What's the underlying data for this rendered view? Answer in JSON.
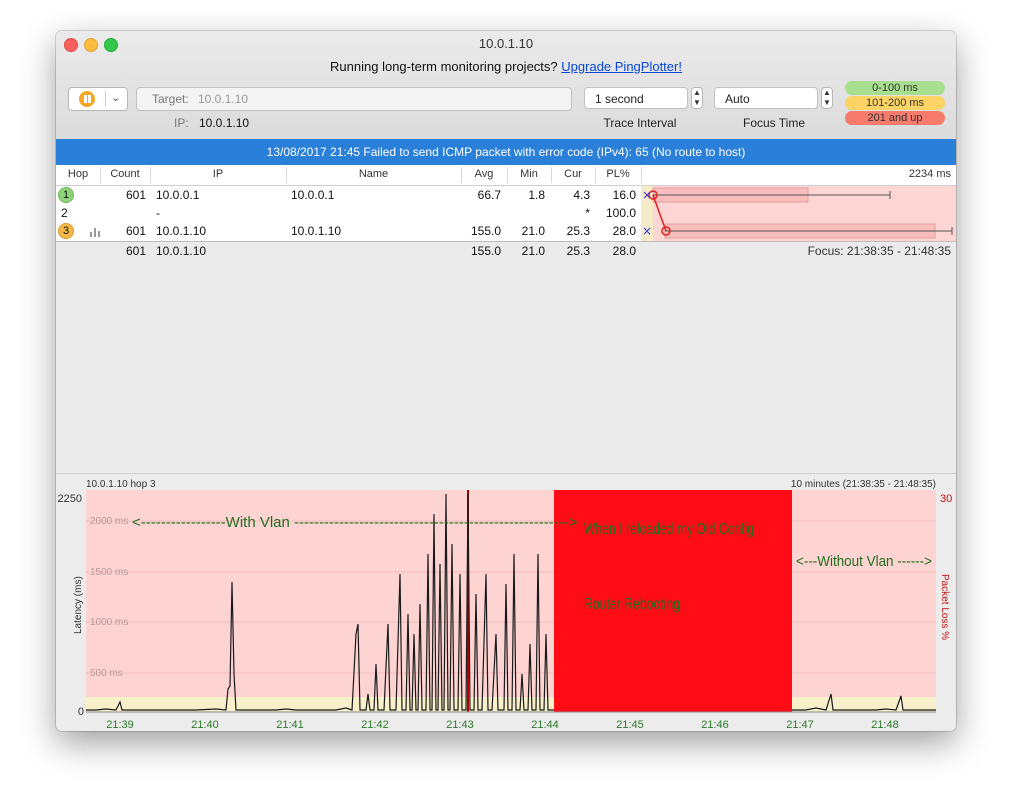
{
  "window": {
    "title": "10.0.1.10"
  },
  "promo": {
    "text": "Running long-term monitoring projects?",
    "link": "Upgrade PingPlotter!"
  },
  "toolbar": {
    "target_label": "Target:",
    "target_value": "10.0.1.10",
    "ip_label": "IP:",
    "ip_value": "10.0.1.10",
    "trace_interval": {
      "value": "1 second",
      "label": "Trace Interval"
    },
    "focus_time": {
      "value": "Auto",
      "label": "Focus Time"
    },
    "latency_legend": [
      {
        "label": "0-100 ms",
        "color": "#a8df8f"
      },
      {
        "label": "101-200 ms",
        "color": "#fbd465"
      },
      {
        "label": "201 and up",
        "color": "#f77b6d"
      }
    ]
  },
  "banner": {
    "text": "13/08/2017 21:45 Failed to send ICMP packet with error code (IPv4): 65 (No route to host)"
  },
  "table": {
    "columns": [
      "Hop",
      "Count",
      "IP",
      "Name",
      "Avg",
      "Min",
      "Cur",
      "PL%"
    ],
    "max_latency": "2234 ms",
    "rows": [
      {
        "hop": "1",
        "count": "601",
        "ip": "10.0.0.1",
        "name": "10.0.0.1",
        "avg": "66.7",
        "min": "1.8",
        "cur": "4.3",
        "pl": "16.0",
        "badge_color": "#8fd47a"
      },
      {
        "hop": "2",
        "count": "",
        "ip": "-",
        "name": "",
        "avg": "",
        "min": "",
        "cur": "*",
        "pl": "100.0",
        "badge_color": ""
      },
      {
        "hop": "3",
        "count": "601",
        "ip": "10.0.1.10",
        "name": "10.0.1.10",
        "avg": "155.0",
        "min": "21.0",
        "cur": "25.3",
        "pl": "28.0",
        "badge_color": "#f5b94a"
      }
    ],
    "summary": {
      "count": "601",
      "ip": "10.0.1.10",
      "avg": "155.0",
      "min": "21.0",
      "cur": "25.3",
      "pl": "28.0",
      "focus": "Focus: 21:38:35 - 21:48:35"
    }
  },
  "timeline": {
    "target": "10.0.1.10 hop 3",
    "range": "10 minutes (21:38:35 - 21:48:35)",
    "y_max_label": "2250",
    "y_min_label": "0",
    "pl_max_label": "30",
    "y_axis_label": "Latency (ms)",
    "pl_axis_label": "Packet Loss %",
    "gridlines": [
      "2000 ms",
      "1500 ms",
      "1000 ms",
      "500 ms"
    ],
    "x_ticks": [
      "21:39",
      "21:40",
      "21:41",
      "21:42",
      "21:43",
      "21:44",
      "21:45",
      "21:46",
      "21:47",
      "21:48"
    ],
    "annotations": {
      "with_vlan": "<-----------------With Vlan ------------------------------------------------------->",
      "reload": "When I reloaded my Old Config",
      "reboot": "Router Rebooting",
      "without_vlan": "<---Without Vlan ------>"
    }
  }
}
